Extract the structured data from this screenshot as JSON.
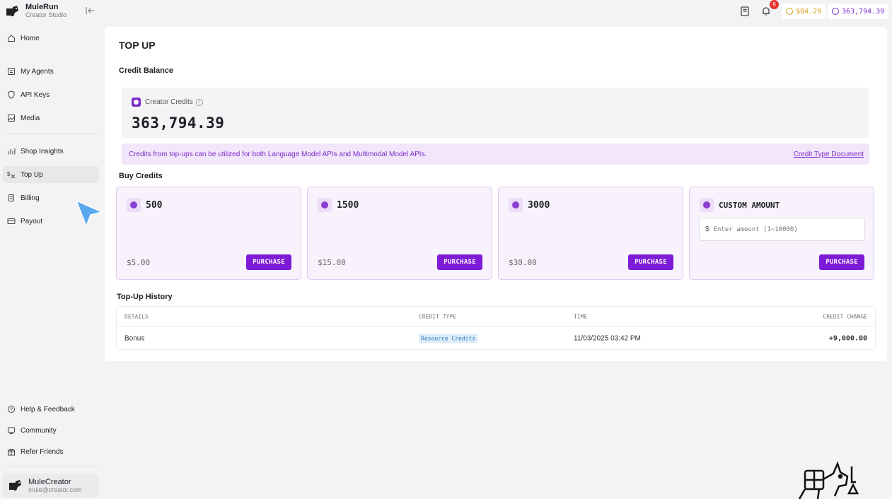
{
  "brand": {
    "name": "MuleRun",
    "subtitle": "Creator Studio"
  },
  "sidebar": {
    "items": [
      {
        "label": "Home",
        "icon": "home-icon"
      },
      {
        "label": "My Agents",
        "icon": "agents-icon"
      },
      {
        "label": "API Keys",
        "icon": "shield-icon"
      },
      {
        "label": "Media",
        "icon": "image-icon"
      },
      {
        "label": "Shop Insights",
        "icon": "chart-icon"
      },
      {
        "label": "Top Up",
        "icon": "topup-icon",
        "active": true
      },
      {
        "label": "Billing",
        "icon": "billing-icon"
      },
      {
        "label": "Payout",
        "icon": "card-icon"
      }
    ],
    "footer": [
      {
        "label": "Help & Feedback",
        "icon": "help-icon"
      },
      {
        "label": "Community",
        "icon": "community-icon"
      },
      {
        "label": "Refer Friends",
        "icon": "gift-icon"
      }
    ],
    "user": {
      "name": "MuleCreator",
      "email": "mule@creator.com"
    }
  },
  "topbar": {
    "notification_count": "9",
    "balance_usd": "$84.29",
    "balance_credits": "363,794.39"
  },
  "page": {
    "title": "TOP UP",
    "credit_balance_heading": "Credit Balance",
    "creator_credits_label": "Creator Credits",
    "creator_credits_value": "363,794.39",
    "notice_text": "Credits from top-ups can be utilized for both Language Model APIs and Multimodal Model APIs.",
    "notice_link": "Credit Type Document",
    "buy_heading": "Buy Credits",
    "packages": [
      {
        "amount": "500",
        "price": "$5.00",
        "button": "PURCHASE"
      },
      {
        "amount": "1500",
        "price": "$15.00",
        "button": "PURCHASE"
      },
      {
        "amount": "3000",
        "price": "$30.00",
        "button": "PURCHASE"
      }
    ],
    "custom": {
      "title": "CUSTOM AMOUNT",
      "currency": "$",
      "placeholder": "Enter amount (1~10000)",
      "button": "PURCHASE"
    },
    "history_heading": "Top-Up History",
    "history_columns": [
      "DETAILS",
      "CREDIT TYPE",
      "TIME",
      "CREDIT CHANGE"
    ],
    "history_rows": [
      {
        "details": "Bonus",
        "credit_type": "Resource Credits",
        "time": "11/03/2025 03:42 PM",
        "change": "+9,000.00"
      }
    ]
  },
  "colors": {
    "accent": "#7e1bd6",
    "notice_bg": "#f2e6fb",
    "usd_pill": "#d4a017",
    "credit_pill": "#7e2cc9"
  }
}
